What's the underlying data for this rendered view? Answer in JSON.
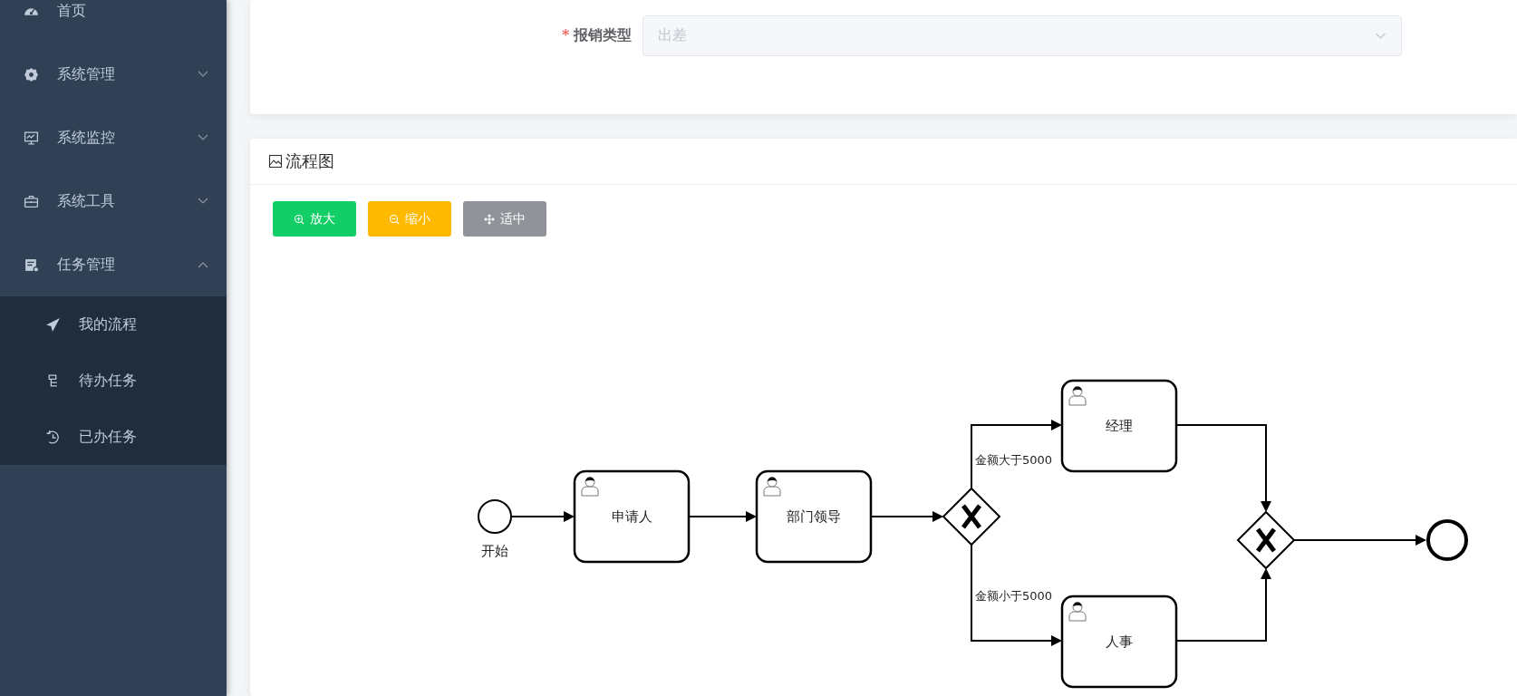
{
  "sidebar": {
    "items": [
      {
        "label": "首页",
        "kind": "link"
      },
      {
        "label": "系统管理",
        "kind": "submenu",
        "expanded": false
      },
      {
        "label": "系统监控",
        "kind": "submenu",
        "expanded": false
      },
      {
        "label": "系统工具",
        "kind": "submenu",
        "expanded": false
      },
      {
        "label": "任务管理",
        "kind": "submenu",
        "expanded": true,
        "children": [
          {
            "label": "我的流程"
          },
          {
            "label": "待办任务"
          },
          {
            "label": "已办任务"
          }
        ]
      }
    ]
  },
  "form": {
    "label": "报销类型",
    "required_mark": "*",
    "value": "出差",
    "disabled": true
  },
  "panel": {
    "title": "流程图",
    "buttons": [
      {
        "label": "放大",
        "kind": "zoom-in"
      },
      {
        "label": "缩小",
        "kind": "zoom-out"
      },
      {
        "label": "适中",
        "kind": "fit"
      }
    ]
  },
  "diagram": {
    "nodes": [
      {
        "kind": "start",
        "label": "开始"
      },
      {
        "kind": "task",
        "label": "申请人"
      },
      {
        "kind": "task",
        "label": "部门领导"
      },
      {
        "kind": "gateway"
      },
      {
        "kind": "task",
        "label": "经理"
      },
      {
        "kind": "task",
        "label": "人事"
      },
      {
        "kind": "gateway"
      },
      {
        "kind": "end"
      }
    ],
    "flow_labels": [
      {
        "label": "金额大于5000"
      },
      {
        "label": "金额小于5000"
      }
    ]
  }
}
